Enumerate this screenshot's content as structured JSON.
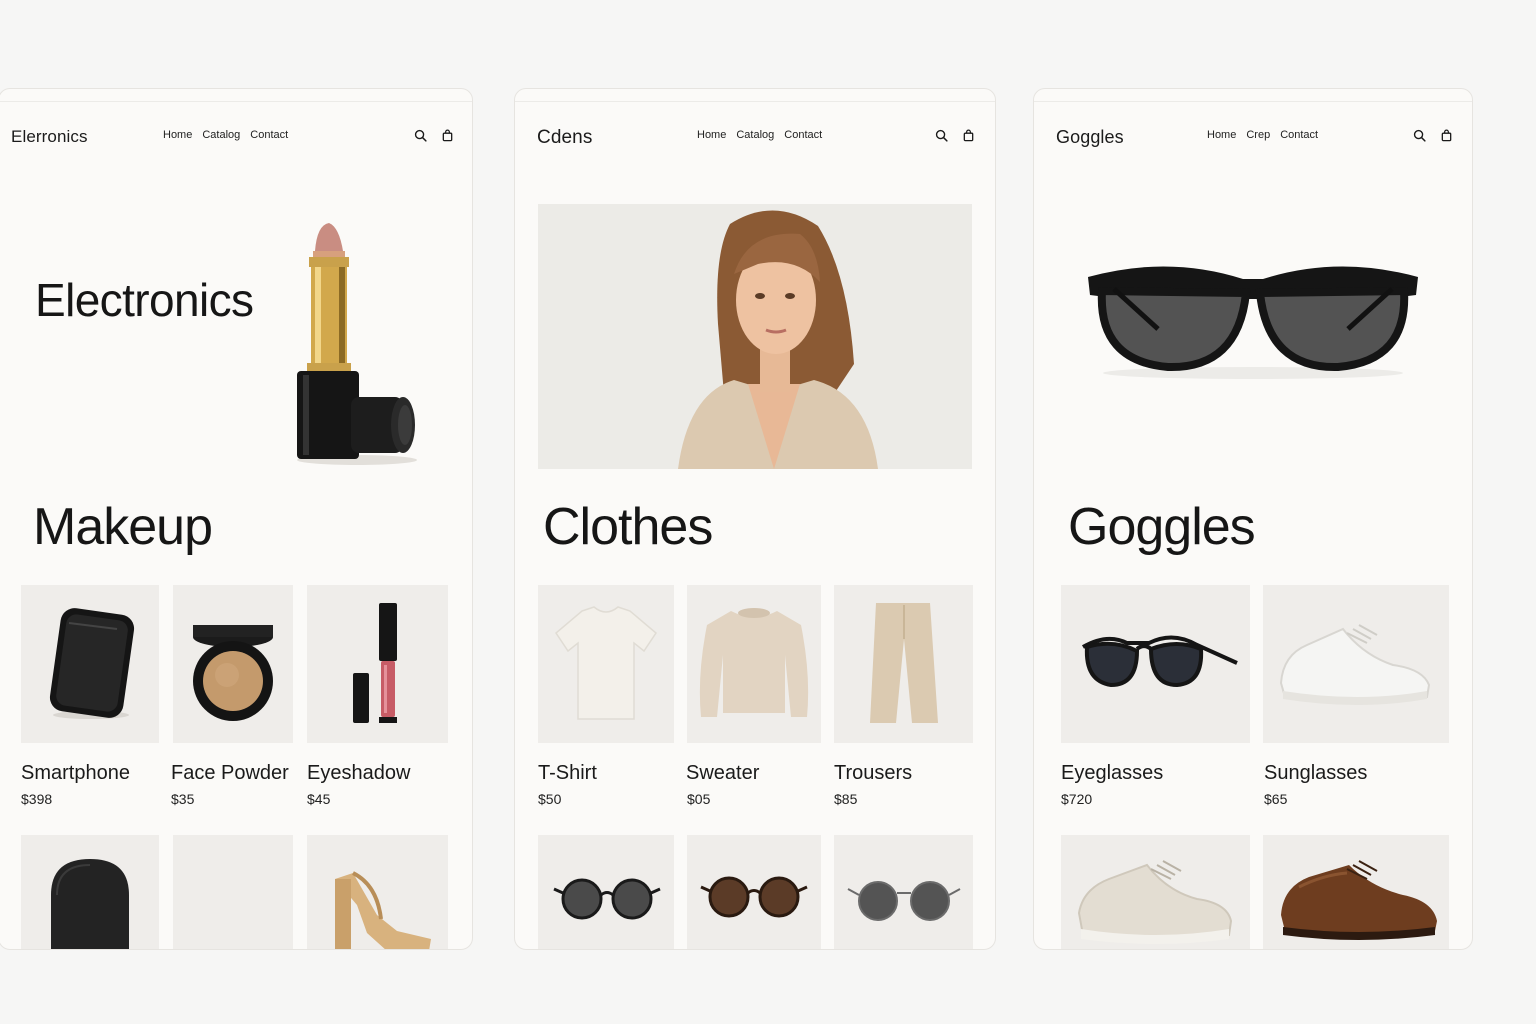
{
  "panels": [
    {
      "brand": "Elerronics",
      "nav": [
        "Home",
        "Catalog",
        "Contact"
      ],
      "hero_title": "Electronics",
      "section_title": "Makeup",
      "products": [
        {
          "name": "Smartphone",
          "price": "$398",
          "icon": "smartphone"
        },
        {
          "name": "Face Powder",
          "price": "$35",
          "icon": "face-powder"
        },
        {
          "name": "Eyeshadow",
          "price": "$45",
          "icon": "lip-gloss"
        }
      ],
      "more": [
        {
          "icon": "smart-speaker"
        },
        {
          "icon": "empty"
        },
        {
          "icon": "heeled-sandal"
        }
      ]
    },
    {
      "brand": "Cdens",
      "nav": [
        "Home",
        "Catalog",
        "Contact"
      ],
      "section_title": "Clothes",
      "products": [
        {
          "name": "T-Shirt",
          "price": "$50",
          "icon": "t-shirt"
        },
        {
          "name": "Sweater",
          "price": "$05",
          "icon": "sweater"
        },
        {
          "name": "Trousers",
          "price": "$85",
          "icon": "trousers"
        }
      ],
      "more": [
        {
          "icon": "sunglasses"
        },
        {
          "icon": "sunglasses"
        },
        {
          "icon": "sunglasses"
        }
      ]
    },
    {
      "brand": "Goggles",
      "nav": [
        "Home",
        "Crep",
        "Contact"
      ],
      "section_title": "Goggles",
      "products": [
        {
          "name": "Eyeglasses",
          "price": "$720",
          "icon": "cat-eye-sunglasses"
        },
        {
          "name": "Sunglasses",
          "price": "$65",
          "icon": "sneaker"
        }
      ],
      "more": [
        {
          "icon": "sneaker"
        },
        {
          "icon": "derby-shoe"
        }
      ]
    }
  ],
  "colors": {
    "page_bg": "#f6f6f5",
    "panel_bg": "#fbfaf8",
    "tile_bg": "#efedea",
    "text": "#1a1a1a"
  }
}
